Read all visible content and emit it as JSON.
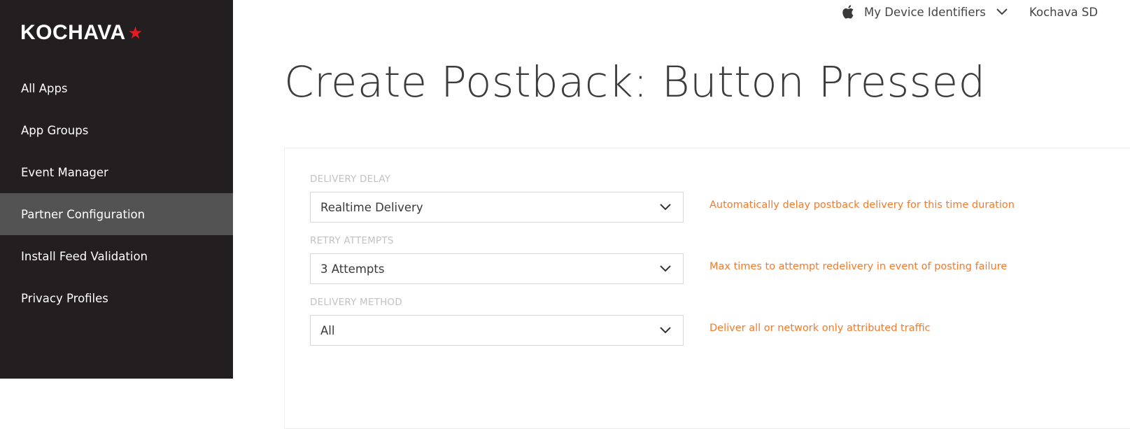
{
  "brand": {
    "name": "KOCHAVA",
    "star": "★",
    "accent": "#e31b23"
  },
  "sidebar": {
    "items": [
      {
        "label": "All Apps",
        "active": false
      },
      {
        "label": "App Groups",
        "active": false
      },
      {
        "label": "Event Manager",
        "active": false
      },
      {
        "label": "Partner Configuration",
        "active": true
      },
      {
        "label": "Install Feed Validation",
        "active": false
      },
      {
        "label": "Privacy Profiles",
        "active": false
      }
    ]
  },
  "topbar": {
    "device_menu_label": "My Device Identifiers",
    "device_icon": "apple-icon",
    "app_label": "Kochava SD"
  },
  "page": {
    "title": "Create Postback: Button Pressed"
  },
  "form": {
    "fields": [
      {
        "label": "DELIVERY DELAY",
        "value": "Realtime Delivery",
        "hint": "Automatically delay postback delivery for this time duration"
      },
      {
        "label": "RETRY ATTEMPTS",
        "value": "3 Attempts",
        "hint": "Max times to attempt redelivery in event of posting failure"
      },
      {
        "label": "DELIVERY METHOD",
        "value": "All",
        "hint": "Deliver all or network only attributed traffic"
      }
    ]
  },
  "colors": {
    "sidebar_bg": "#231f20",
    "sidebar_active": "#535353",
    "hint": "#f47a2a"
  }
}
